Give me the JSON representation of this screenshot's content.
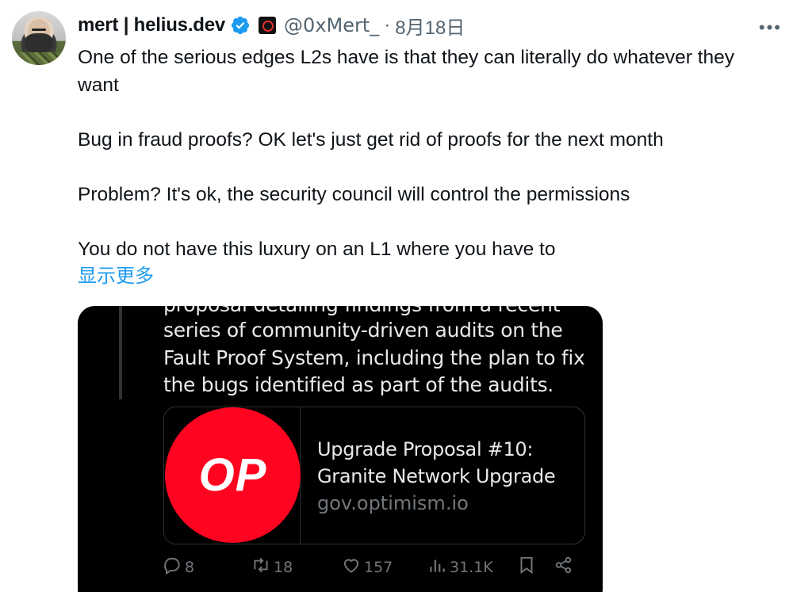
{
  "author": {
    "name": "mert | helius.dev",
    "handle": "@0xMert_",
    "separator": "·",
    "date": "8月18日",
    "avatar_icon": "avatar-bearded-man",
    "verified_icon": "verified-badge-icon",
    "affiliate_icon": "helius-affiliate-icon"
  },
  "more_label": "•••",
  "tweet": {
    "line1": "One of the serious edges L2s have is that they can literally do whatever they want",
    "line2": "Bug in fraud proofs? OK let's just get rid of proofs for the next month",
    "line3": "Problem? It's ok, the security council will control the permissions",
    "line4": "You do not have this luxury on an L1 where you have to",
    "show_more": "显示更多"
  },
  "quoted": {
    "clipped_line": "proposal detailing findings from a recent",
    "text": "series of community-driven audits on the Fault Proof System, including the plan to fix the bugs identified as part of the audits.",
    "link_card": {
      "thumb_text": "OP",
      "title": "Upgrade Proposal #10: Granite Network Upgrade",
      "domain": "gov.optimism.io"
    },
    "actions": {
      "replies": "8",
      "reposts": "18",
      "likes": "157",
      "views": "31.1K"
    }
  },
  "colors": {
    "accent": "#1d9bf0",
    "op_red": "#ff0420",
    "card_bg": "#000000"
  }
}
